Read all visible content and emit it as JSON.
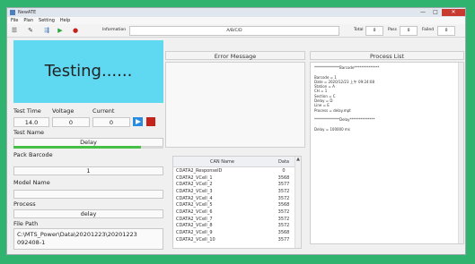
{
  "window": {
    "title": "NewATE",
    "min": "—",
    "max": "□",
    "close": "✕"
  },
  "menu": [
    "File",
    "Plan",
    "Setting",
    "Help"
  ],
  "toolbar": {
    "info_label": "Information",
    "info_value": "A/B/C/D",
    "total_label": "Total",
    "total_value": "0",
    "pass_label": "Pass",
    "pass_value": "0",
    "failed_label": "Failed",
    "failed_value": "0"
  },
  "status": {
    "banner": "Testing......"
  },
  "fields": {
    "test_time_label": "Test Time",
    "voltage_label": "Voltage",
    "current_label": "Current",
    "test_time": "14.0",
    "voltage": "0",
    "current": "0",
    "test_name_label": "Test Name",
    "test_name": "Delay",
    "pack_barcode_label": "Pack Barcode",
    "pack_barcode": "1",
    "model_name_label": "Model Name",
    "model_name": "",
    "process_label": "Process",
    "process": "delay",
    "file_path_label": "File Path",
    "file_path_1": "C:\\MTS_Power\\Data\\20201223\\20201223",
    "file_path_2": "092408-1"
  },
  "progress": 0.85,
  "error": {
    "title": "Error Message"
  },
  "process_list": {
    "title": "Process List",
    "lines": [
      "**************Barcode**************",
      "",
      "Barcode = 1",
      "Date = 2020/12/23 上午 09:24:08",
      "Station = A",
      "CH = 1",
      "Section = C",
      "Delay = D",
      "Line = E",
      "Process = delay.mpt",
      "",
      "**************Delay**************",
      "",
      "Delay = 100000 ms"
    ]
  },
  "can_table": {
    "headers": [
      "CAN Name",
      "Data"
    ],
    "rows": [
      [
        "CDATA2_ResponseID",
        "0"
      ],
      [
        "CDATA2_VCell_1",
        "3568"
      ],
      [
        "CDATA2_VCell_2",
        "3577"
      ],
      [
        "CDATA2_VCell_3",
        "3572"
      ],
      [
        "CDATA2_VCell_4",
        "3572"
      ],
      [
        "CDATA2_VCell_5",
        "3568"
      ],
      [
        "CDATA2_VCell_6",
        "3572"
      ],
      [
        "CDATA2_VCell_7",
        "3572"
      ],
      [
        "CDATA2_VCell_8",
        "3572"
      ],
      [
        "CDATA2_VCell_9",
        "3568"
      ],
      [
        "CDATA2_VCell_10",
        "3577"
      ]
    ]
  },
  "colors": {
    "banner": "#5fd9f2",
    "desktop": "#2fb36e",
    "play": "#2a8adf",
    "stop": "#c4231c",
    "progress": "#44c045"
  }
}
